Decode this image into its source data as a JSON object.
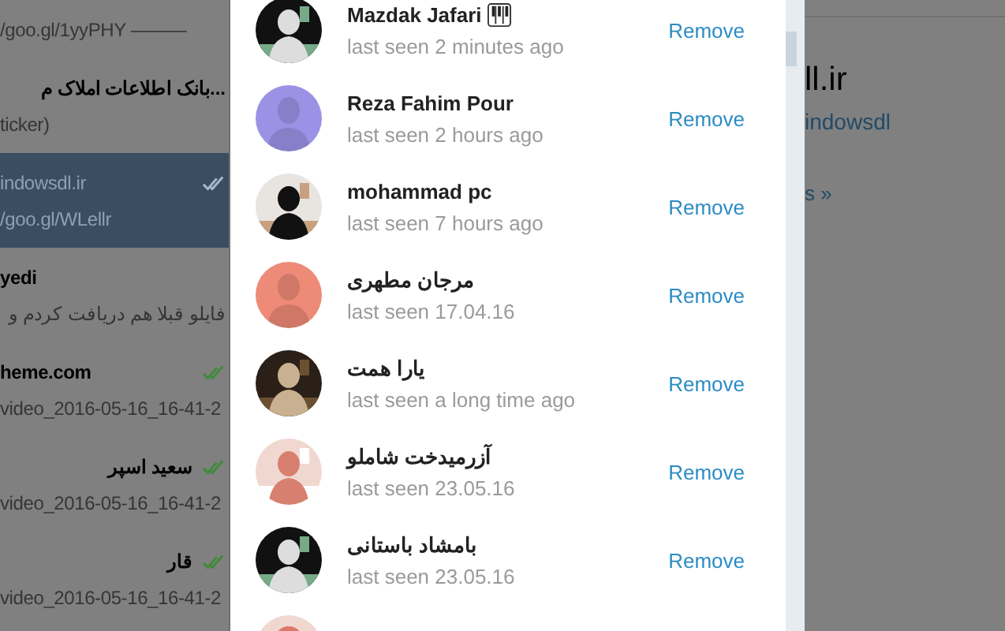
{
  "chats": [
    {
      "preview": "/goo.gl/1yyPHY ———",
      "checked": false,
      "selected": false
    },
    {
      "title": "...بانک اطلاعات املاک م",
      "preview": "ticker)",
      "checked": false,
      "selected": false
    },
    {
      "title": "indowsdl.ir",
      "preview": "/goo.gl/WLellr",
      "checked": true,
      "selected": true
    },
    {
      "title": "yedi",
      "preview": "فایلو قبلا هم دریافت کردم و",
      "checked": false,
      "selected": false
    },
    {
      "title": "heme.com",
      "preview": "video_2016-05-16_16-41-2",
      "checked": true,
      "selected": false
    },
    {
      "title": "سعید اسپر",
      "preview": "video_2016-05-16_16-41-2",
      "checked": true,
      "selected": false
    },
    {
      "title": "قار",
      "preview": "video_2016-05-16_16-41-2",
      "checked": true,
      "selected": false
    }
  ],
  "members": [
    {
      "name": "Mazdak Jafari",
      "status": "last seen 2 minutes ago",
      "badge": true,
      "action": "Remove"
    },
    {
      "name": "Reza Fahim Pour",
      "status": "last seen 2 hours ago",
      "avatar": {
        "kind": "placeholder",
        "color": "#9b92e6"
      },
      "badge": false,
      "action": "Remove"
    },
    {
      "name": "mohammad pc",
      "status": "last seen 7 hours ago",
      "badge": false,
      "action": "Remove"
    },
    {
      "name": "مرجان مطهری",
      "status": "last seen 17.04.16",
      "avatar": {
        "kind": "placeholder",
        "color": "#ee8a78"
      },
      "badge": false,
      "action": "Remove"
    },
    {
      "name": "یارا همت",
      "status": "last seen a long time ago",
      "badge": false,
      "action": "Remove"
    },
    {
      "name": "آزرمیدخت شاملو",
      "status": "last seen 23.05.16",
      "badge": false,
      "action": "Remove"
    },
    {
      "name": "بامشاد باستانی",
      "status": "last seen 23.05.16",
      "badge": false,
      "action": "Remove"
    }
  ],
  "background_page": {
    "heading": "ll.ir",
    "link": "indowsdl",
    "more": "s »"
  }
}
